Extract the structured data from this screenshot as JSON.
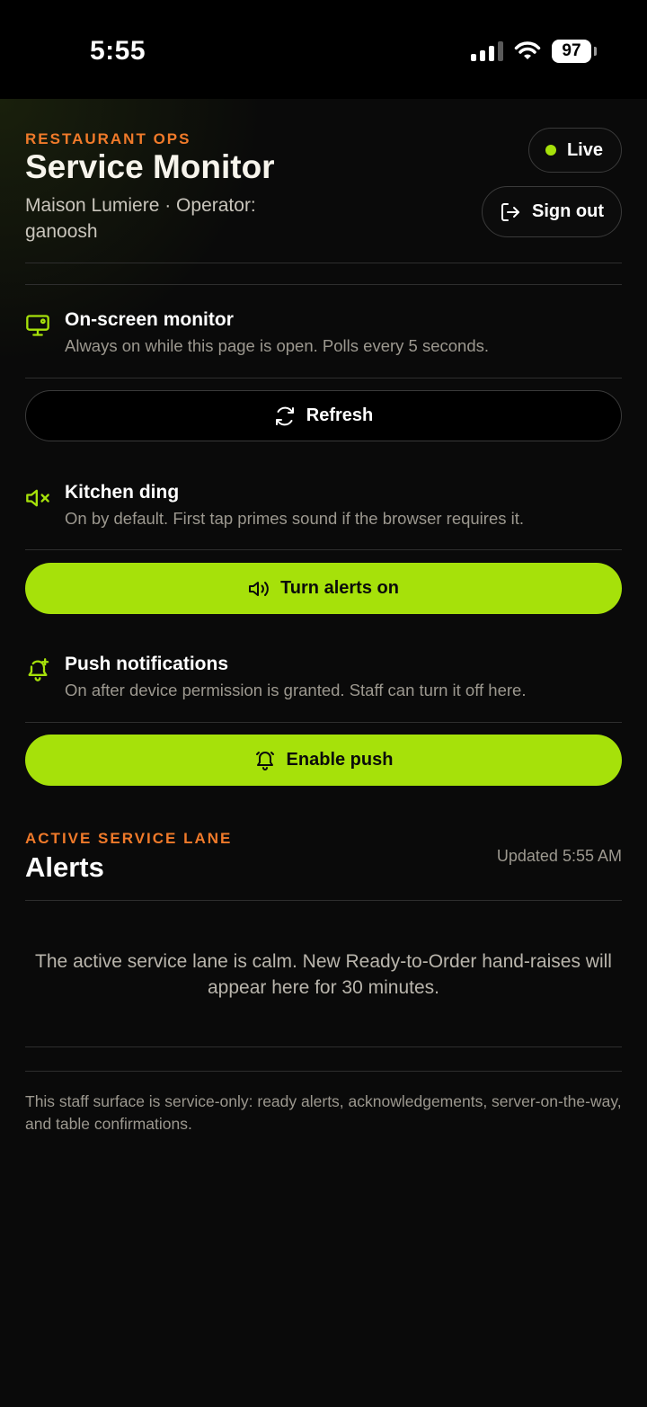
{
  "status_bar": {
    "time": "5:55",
    "battery": "97"
  },
  "header": {
    "eyebrow": "RESTAURANT OPS",
    "title": "Service Monitor",
    "subtitle": "Maison Lumiere · Operator: ganoosh",
    "live_label": "Live",
    "signout_label": "Sign out"
  },
  "settings": {
    "monitor": {
      "title": "On-screen monitor",
      "desc": "Always on while this page is open. Polls every 5 seconds."
    },
    "refresh_label": "Refresh",
    "ding": {
      "title": "Kitchen ding",
      "desc": "On by default. First tap primes sound if the browser requires it."
    },
    "alerts_button_label": "Turn alerts on",
    "push": {
      "title": "Push notifications",
      "desc": "On after device permission is granted. Staff can turn it off here."
    },
    "push_button_label": "Enable push"
  },
  "alerts": {
    "eyebrow": "ACTIVE SERVICE LANE",
    "title": "Alerts",
    "updated": "Updated 5:55 AM",
    "empty_text": "The active service lane is calm. New Ready-to-Order hand-raises will appear here for 30 minutes."
  },
  "footer": {
    "text": "This staff surface is service-only: ready alerts, acknowledgements, server-on-the-way, and table confirmations."
  },
  "colors": {
    "accent": "#a6e10a",
    "eyebrow": "#f07a2a",
    "background": "#0a0a0a"
  },
  "icons": [
    "monitor-icon",
    "refresh-icon",
    "speaker-muted-icon",
    "speaker-icon",
    "bell-plus-icon",
    "bell-icon",
    "signout-icon"
  ]
}
